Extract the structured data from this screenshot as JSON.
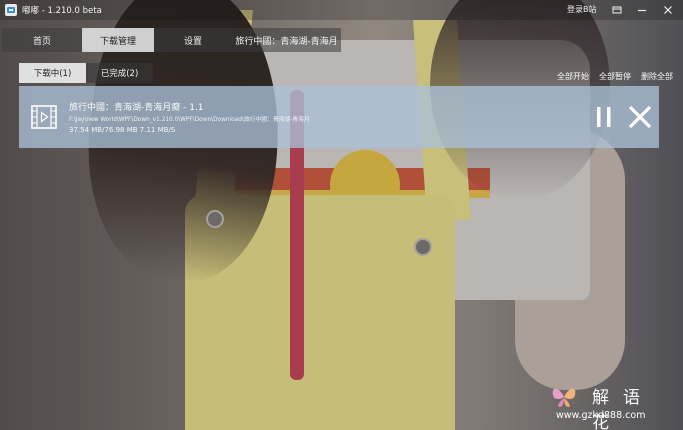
{
  "window": {
    "app_icon": "app-logo-icon",
    "title": "嘟嘟 - 1.210.0 beta",
    "login_link": "登录B站",
    "controls": [
      "skin-icon",
      "minimize-icon",
      "maximize-icon",
      "close-icon"
    ]
  },
  "main_tabs": [
    {
      "label": "首页",
      "active": false
    },
    {
      "label": "下载管理",
      "active": true
    },
    {
      "label": "设置",
      "active": false
    },
    {
      "label": "旅行中國：青海湖-青海月",
      "active": false
    }
  ],
  "sub_tabs": [
    {
      "label": "下载中(1)",
      "active": true
    },
    {
      "label": "已完成(2)",
      "active": false
    }
  ],
  "bulk_actions": {
    "start_all": "全部开始",
    "pause_all": "全部暂停",
    "delete_all": "删除全部"
  },
  "downloads": [
    {
      "icon": "video-file-icon",
      "title": "旅行中國：青海湖-青海月癡 - 1.1",
      "path": "F:\\Jay\\new World\\WPF\\Down_v1.210.0\\WPF\\Down\\Download\\旅行中國：青海湖-青海月",
      "progress_text": "37.54 MB/76.98 MB 7.11 MB/S",
      "downloaded_mb": 37.54,
      "total_mb": 76.98,
      "speed": "7.11 MB/S",
      "actions": [
        "pause-icon",
        "cancel-icon"
      ]
    }
  ],
  "watermark": {
    "text": "解语花",
    "url": "www.gzkd888.com"
  },
  "colors": {
    "row_highlight": "#aac0d7",
    "active_tab": "#ebebeb"
  }
}
